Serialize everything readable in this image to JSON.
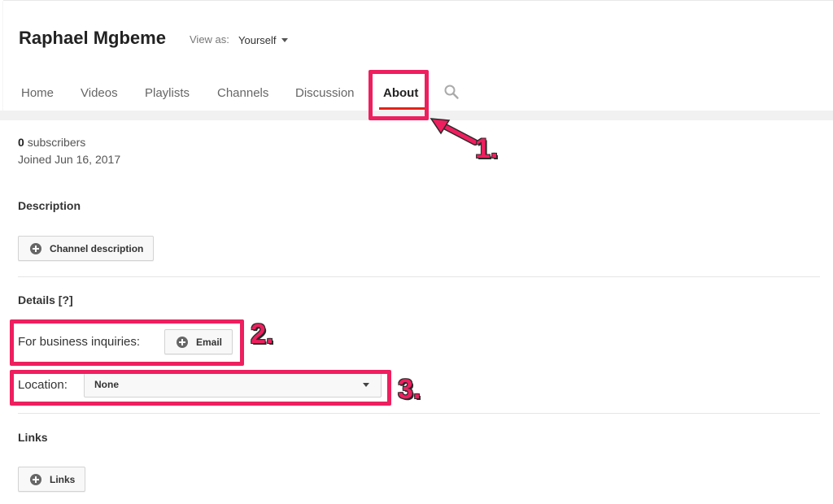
{
  "channel": {
    "name": "Raphael Mgbeme"
  },
  "view_as": {
    "label": "View as:",
    "value": "Yourself"
  },
  "tabs": [
    {
      "label": "Home"
    },
    {
      "label": "Videos"
    },
    {
      "label": "Playlists"
    },
    {
      "label": "Channels"
    },
    {
      "label": "Discussion"
    },
    {
      "label": "About",
      "active": true
    }
  ],
  "stats": {
    "subscriber_count": "0",
    "subscribers_label": "subscribers",
    "joined": "Joined Jun 16, 2017"
  },
  "description": {
    "heading": "Description",
    "button_label": "Channel description"
  },
  "details": {
    "heading": "Details [?]",
    "business_label": "For business inquiries:",
    "email_button": "Email",
    "location_label": "Location:",
    "location_value": "None"
  },
  "links": {
    "heading": "Links",
    "button_label": "Links"
  },
  "annotations": {
    "one": "1.",
    "two": "2.",
    "three": "3."
  },
  "colors": {
    "highlight": "#ee1f5f",
    "tab_underline": "#e62117"
  }
}
